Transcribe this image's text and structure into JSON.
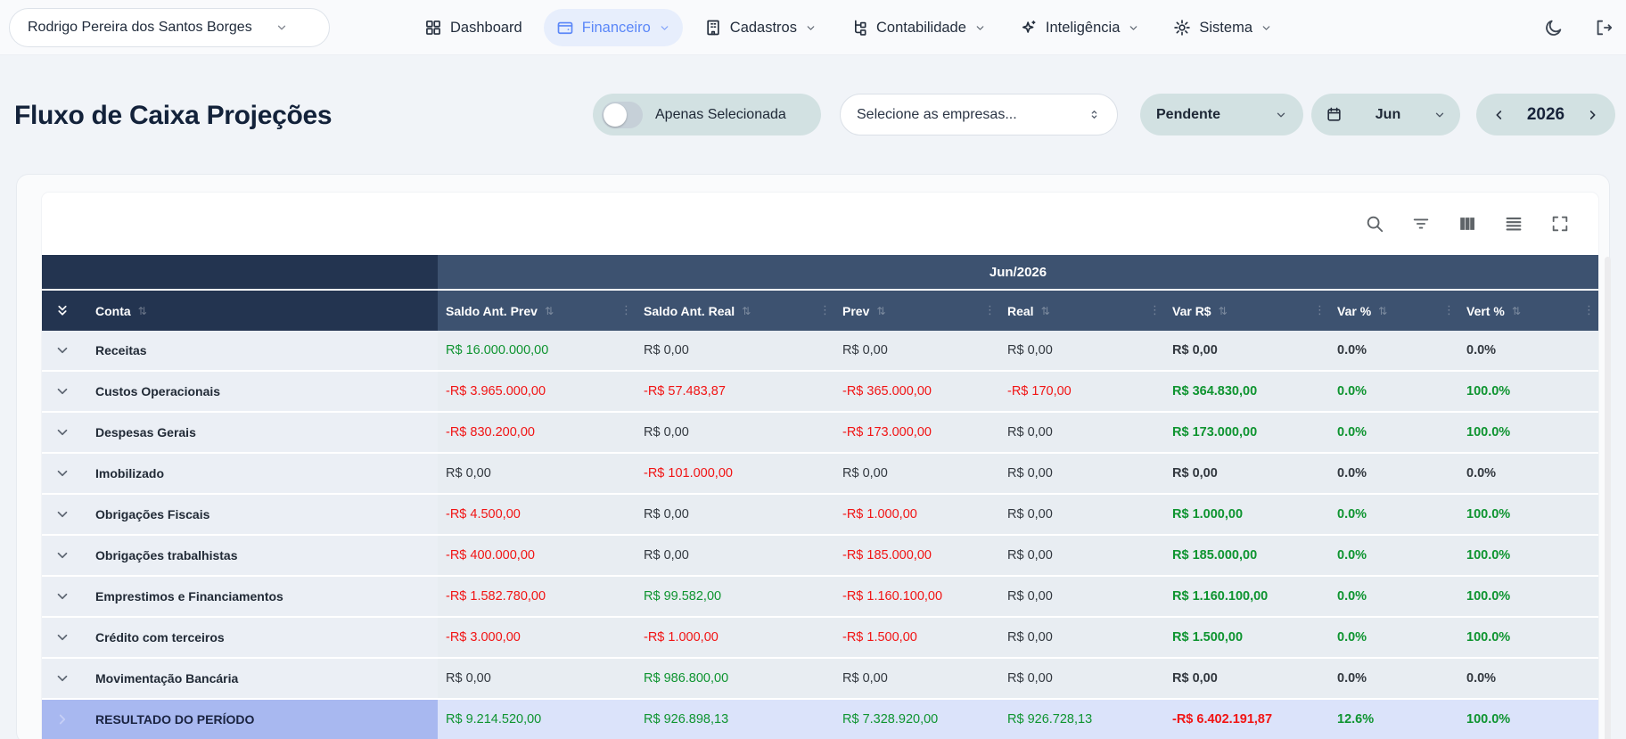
{
  "topbar": {
    "user": {
      "name": "Rodrigo Pereira dos Santos Borges"
    },
    "nav": [
      {
        "label": "Dashboard"
      },
      {
        "label": "Financeiro"
      },
      {
        "label": "Cadastros"
      },
      {
        "label": "Contabilidade"
      },
      {
        "label": "Inteligência"
      },
      {
        "label": "Sistema"
      }
    ]
  },
  "page": {
    "title": "Fluxo de Caixa Projeções"
  },
  "filters": {
    "only_selected_label": "Apenas Selecionada",
    "only_selected_on": false,
    "companies_placeholder": "Selecione as empresas...",
    "status_value": "Pendente",
    "month_value": "Jun",
    "year_value": "2026"
  },
  "colors": {
    "accent_active": "#5b87f8",
    "pill_teal": "#d2e1e2",
    "header_dark_navy": "#233450",
    "header_slate": "#3d5270",
    "positive_green": "#0e9430",
    "negative_red": "#f11414",
    "neutral_dark": "#32383f",
    "summary_left_bg": "#a8b8f0",
    "summary_right_bg": "#dbe3fa"
  },
  "table": {
    "period_header": "Jun/2026",
    "columns": [
      "Conta",
      "Saldo Ant. Prev",
      "Saldo Ant. Real",
      "Prev",
      "Real",
      "Var R$",
      "Var %",
      "Vert %"
    ],
    "rows": [
      {
        "name": "Receitas",
        "summary": false,
        "cells": [
          {
            "v": "R$ 16.000.000,00",
            "c": "pos"
          },
          {
            "v": "R$ 0,00",
            "c": "zero"
          },
          {
            "v": "R$ 0,00",
            "c": "zero"
          },
          {
            "v": "R$ 0,00",
            "c": "zero"
          },
          {
            "v": "R$ 0,00",
            "c": "zero"
          },
          {
            "v": "0.0%",
            "c": "zero"
          },
          {
            "v": "0.0%",
            "c": "zero"
          }
        ]
      },
      {
        "name": "Custos Operacionais",
        "summary": false,
        "cells": [
          {
            "v": "-R$ 3.965.000,00",
            "c": "neg"
          },
          {
            "v": "-R$ 57.483,87",
            "c": "neg"
          },
          {
            "v": "-R$ 365.000,00",
            "c": "neg"
          },
          {
            "v": "-R$ 170,00",
            "c": "neg"
          },
          {
            "v": "R$ 364.830,00",
            "c": "pos"
          },
          {
            "v": "0.0%",
            "c": "pos"
          },
          {
            "v": "100.0%",
            "c": "pos"
          }
        ]
      },
      {
        "name": "Despesas Gerais",
        "summary": false,
        "cells": [
          {
            "v": "-R$ 830.200,00",
            "c": "neg"
          },
          {
            "v": "R$ 0,00",
            "c": "zero"
          },
          {
            "v": "-R$ 173.000,00",
            "c": "neg"
          },
          {
            "v": "R$ 0,00",
            "c": "zero"
          },
          {
            "v": "R$ 173.000,00",
            "c": "pos"
          },
          {
            "v": "0.0%",
            "c": "pos"
          },
          {
            "v": "100.0%",
            "c": "pos"
          }
        ]
      },
      {
        "name": "Imobilizado",
        "summary": false,
        "cells": [
          {
            "v": "R$ 0,00",
            "c": "zero"
          },
          {
            "v": "-R$ 101.000,00",
            "c": "neg"
          },
          {
            "v": "R$ 0,00",
            "c": "zero"
          },
          {
            "v": "R$ 0,00",
            "c": "zero"
          },
          {
            "v": "R$ 0,00",
            "c": "zero"
          },
          {
            "v": "0.0%",
            "c": "zero"
          },
          {
            "v": "0.0%",
            "c": "zero"
          }
        ]
      },
      {
        "name": "Obrigações Fiscais",
        "summary": false,
        "cells": [
          {
            "v": "-R$ 4.500,00",
            "c": "neg"
          },
          {
            "v": "R$ 0,00",
            "c": "zero"
          },
          {
            "v": "-R$ 1.000,00",
            "c": "neg"
          },
          {
            "v": "R$ 0,00",
            "c": "zero"
          },
          {
            "v": "R$ 1.000,00",
            "c": "pos"
          },
          {
            "v": "0.0%",
            "c": "pos"
          },
          {
            "v": "100.0%",
            "c": "pos"
          }
        ]
      },
      {
        "name": "Obrigações trabalhistas",
        "summary": false,
        "cells": [
          {
            "v": "-R$ 400.000,00",
            "c": "neg"
          },
          {
            "v": "R$ 0,00",
            "c": "zero"
          },
          {
            "v": "-R$ 185.000,00",
            "c": "neg"
          },
          {
            "v": "R$ 0,00",
            "c": "zero"
          },
          {
            "v": "R$ 185.000,00",
            "c": "pos"
          },
          {
            "v": "0.0%",
            "c": "pos"
          },
          {
            "v": "100.0%",
            "c": "pos"
          }
        ]
      },
      {
        "name": "Emprestimos e Financiamentos",
        "summary": false,
        "cells": [
          {
            "v": "-R$ 1.582.780,00",
            "c": "neg"
          },
          {
            "v": "R$ 99.582,00",
            "c": "pos"
          },
          {
            "v": "-R$ 1.160.100,00",
            "c": "neg"
          },
          {
            "v": "R$ 0,00",
            "c": "zero"
          },
          {
            "v": "R$ 1.160.100,00",
            "c": "pos"
          },
          {
            "v": "0.0%",
            "c": "pos"
          },
          {
            "v": "100.0%",
            "c": "pos"
          }
        ]
      },
      {
        "name": "Crédito com terceiros",
        "summary": false,
        "cells": [
          {
            "v": "-R$ 3.000,00",
            "c": "neg"
          },
          {
            "v": "-R$ 1.000,00",
            "c": "neg"
          },
          {
            "v": "-R$ 1.500,00",
            "c": "neg"
          },
          {
            "v": "R$ 0,00",
            "c": "zero"
          },
          {
            "v": "R$ 1.500,00",
            "c": "pos"
          },
          {
            "v": "0.0%",
            "c": "pos"
          },
          {
            "v": "100.0%",
            "c": "pos"
          }
        ]
      },
      {
        "name": "Movimentação Bancária",
        "summary": false,
        "cells": [
          {
            "v": "R$ 0,00",
            "c": "zero"
          },
          {
            "v": "R$ 986.800,00",
            "c": "pos"
          },
          {
            "v": "R$ 0,00",
            "c": "zero"
          },
          {
            "v": "R$ 0,00",
            "c": "zero"
          },
          {
            "v": "R$ 0,00",
            "c": "zero"
          },
          {
            "v": "0.0%",
            "c": "zero"
          },
          {
            "v": "0.0%",
            "c": "zero"
          }
        ]
      },
      {
        "name": "RESULTADO DO PERÍODO",
        "summary": true,
        "cells": [
          {
            "v": "R$ 9.214.520,00",
            "c": "pos"
          },
          {
            "v": "R$ 926.898,13",
            "c": "pos"
          },
          {
            "v": "R$ 7.328.920,00",
            "c": "pos"
          },
          {
            "v": "R$ 926.728,13",
            "c": "pos"
          },
          {
            "v": "-R$ 6.402.191,87",
            "c": "neg"
          },
          {
            "v": "12.6%",
            "c": "pos"
          },
          {
            "v": "100.0%",
            "c": "pos"
          }
        ]
      }
    ]
  }
}
